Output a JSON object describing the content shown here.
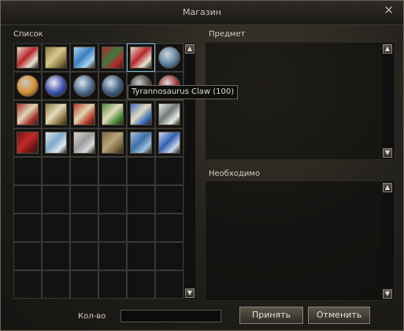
{
  "window": {
    "title": "Магазин",
    "close_glyph": "✕"
  },
  "list": {
    "label": "Список"
  },
  "item_panel": {
    "label": "Предмет"
  },
  "required_panel": {
    "label": "Необходимо"
  },
  "tooltip": {
    "text": "Tyrannosaurus Claw (100)"
  },
  "quantity": {
    "label": "Кол-во",
    "value": ""
  },
  "buttons": {
    "accept": "Принять",
    "cancel": "Отменить"
  },
  "scroll": {
    "up": "▲",
    "down": "▼"
  },
  "items": [
    {
      "icon": "red-gem-bundle-icon",
      "c1": "#b8262a",
      "c2": "#e6e0d2",
      "round": false
    },
    {
      "icon": "scroll-icon",
      "c1": "#d9c98c",
      "c2": "#8c7a44",
      "round": false
    },
    {
      "icon": "blue-scroll-icon",
      "c1": "#3a7fc1",
      "c2": "#a8d4ef",
      "round": false
    },
    {
      "icon": "red-gem-bundle-icon",
      "c1": "#3b7a3c",
      "c2": "#b8262a",
      "round": false
    },
    {
      "icon": "tyrannosaurus-claw-icon",
      "c1": "#b8262a",
      "c2": "#e6e0d2",
      "round": false
    },
    {
      "icon": "crystal-sphere-icon",
      "c1": "#cfd7df",
      "c2": "#5c7f9f",
      "round": true
    },
    {
      "icon": "silver-cube-icon",
      "c1": "#c9c9c9",
      "c2": "#d68e2c",
      "round": true
    },
    {
      "icon": "blue-orb-icon",
      "c1": "#f2f2f2",
      "c2": "#3b4fb0",
      "round": true
    },
    {
      "icon": "swirl-sphere-icon",
      "c1": "#dfe6ee",
      "c2": "#4a6a8c",
      "round": true
    },
    {
      "icon": "swirl-sphere-icon",
      "c1": "#d6dde5",
      "c2": "#3e5f82",
      "round": true
    },
    {
      "icon": "dark-orb-icon",
      "c1": "#c7c7c7",
      "c2": "#505050",
      "round": true
    },
    {
      "icon": "red-orb-icon",
      "c1": "#dcdcdc",
      "c2": "#a03030",
      "round": true
    },
    {
      "icon": "red-scroll-icon",
      "c1": "#e0d7b8",
      "c2": "#a8302c",
      "round": false
    },
    {
      "icon": "scroll-icon",
      "c1": "#e3dbbd",
      "c2": "#8c7a44",
      "round": false
    },
    {
      "icon": "flame-scroll-icon",
      "c1": "#e0d6b0",
      "c2": "#b83a2a",
      "round": false
    },
    {
      "icon": "green-scroll-icon",
      "c1": "#e3dbbd",
      "c2": "#4b8c3a",
      "round": false
    },
    {
      "icon": "blue-flame-scroll-icon",
      "c1": "#e3dbbd",
      "c2": "#3a6fc1",
      "round": false
    },
    {
      "icon": "horn-icon",
      "c1": "#6f7a78",
      "c2": "#e8ebe6",
      "round": false
    },
    {
      "icon": "red-cloak-icon",
      "c1": "#c22a2a",
      "c2": "#6e1515",
      "round": false
    },
    {
      "icon": "ice-crystal-icon",
      "c1": "#7fa9c9",
      "c2": "#dbe8f1",
      "round": false
    },
    {
      "icon": "gray-stone-icon",
      "c1": "#9c9c9c",
      "c2": "#d8d8d8",
      "round": false
    },
    {
      "icon": "parchment-roll-icon",
      "c1": "#b9a57a",
      "c2": "#7a6842",
      "round": false
    },
    {
      "icon": "planet-orb-icon",
      "c1": "#3d6fa8",
      "c2": "#9fc4e0",
      "round": false
    },
    {
      "icon": "blue-crystals-icon",
      "c1": "#2f5fb0",
      "c2": "#c9d9ee",
      "round": false
    }
  ]
}
